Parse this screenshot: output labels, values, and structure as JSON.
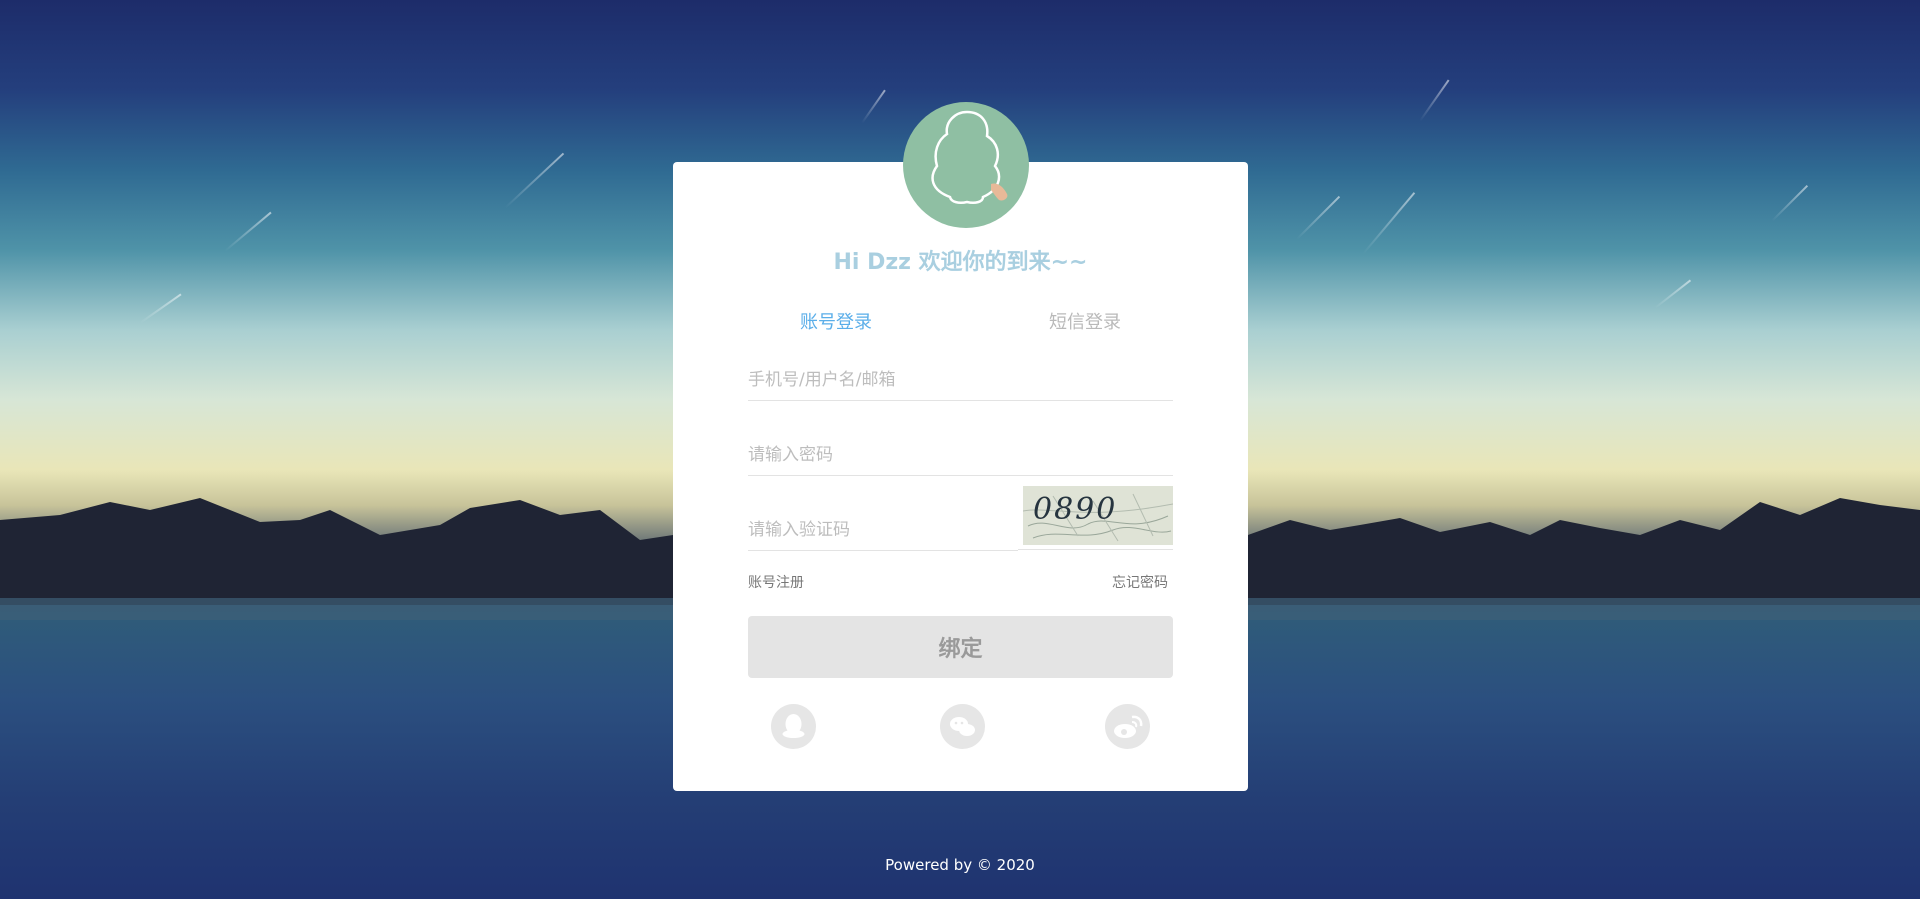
{
  "greeting": "Hi Dzz 欢迎你的到来~~",
  "tabs": {
    "account_login": "账号登录",
    "sms_login": "短信登录"
  },
  "form": {
    "username_placeholder": "手机号/用户名/邮箱",
    "password_placeholder": "请输入密码",
    "captcha_placeholder": "请输入验证码",
    "captcha_code": "0890"
  },
  "links": {
    "register": "账号注册",
    "forgot_password": "忘记密码"
  },
  "submit_label": "绑定",
  "social": [
    {
      "icon": "qq-icon"
    },
    {
      "icon": "wechat-icon"
    },
    {
      "icon": "weibo-icon"
    }
  ],
  "footer": "Powered by © 2020",
  "colors": {
    "active_tab": "#5aaee9",
    "greeting": "#a9cfe0",
    "avatar_bg": "#8fbfa3"
  }
}
